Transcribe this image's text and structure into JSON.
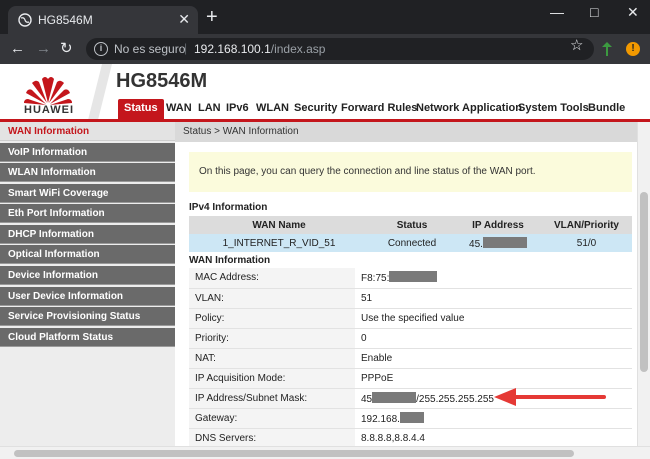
{
  "browser": {
    "tab_title": "HG8546M",
    "tab_close": "✕",
    "new_tab": "+",
    "security_label": "No es seguro",
    "url_host": "192.168.100.1",
    "url_path": "/index.asp",
    "ext_badge": "!"
  },
  "header": {
    "brand": "HUAWEI",
    "model": "HG8546M",
    "nav": [
      "Status",
      "WAN",
      "LAN",
      "IPv6",
      "WLAN",
      "Security",
      "Forward Rules",
      "Network Application",
      "System Tools",
      "Bundle"
    ]
  },
  "sidebar": {
    "items": [
      "WAN Information",
      "VoIP Information",
      "WLAN Information",
      "Smart WiFi Coverage",
      "Eth Port Information",
      "DHCP Information",
      "Optical Information",
      "Device Information",
      "User Device Information",
      "Service Provisioning Status",
      "Cloud Platform Status"
    ]
  },
  "main": {
    "breadcrumb": "Status > WAN Information",
    "notice": "On this page, you can query the connection and line status of the WAN port.",
    "ipv4_title": "IPv4 Information",
    "ipv4_headers": [
      "WAN Name",
      "Status",
      "IP Address",
      "VLAN/Priority"
    ],
    "ipv4_row": {
      "wan_name": "1_INTERNET_R_VID_51",
      "status": "Connected",
      "ip_prefix": "45.",
      "vlan_priority": "51/0"
    },
    "wan_title": "WAN Information",
    "wan_rows": {
      "mac_label": "MAC Address:",
      "mac_prefix": "F8:75:",
      "vlan_label": "VLAN:",
      "vlan_value": "51",
      "policy_label": "Policy:",
      "policy_value": "Use the specified value",
      "priority_label": "Priority:",
      "priority_value": "0",
      "nat_label": "NAT:",
      "nat_value": "Enable",
      "acq_label": "IP Acquisition Mode:",
      "acq_value": "PPPoE",
      "ipmask_label": "IP Address/Subnet Mask:",
      "ip_prefix": "45",
      "mask_suffix": "/255.255.255.255",
      "gateway_label": "Gateway:",
      "gateway_prefix": "192.168.",
      "dns_label": "DNS Servers:",
      "dns_value": "8.8.8.8,8.8.4.4"
    }
  },
  "colors": {
    "brand_red": "#c4161c",
    "arrow_red": "#e53935"
  }
}
